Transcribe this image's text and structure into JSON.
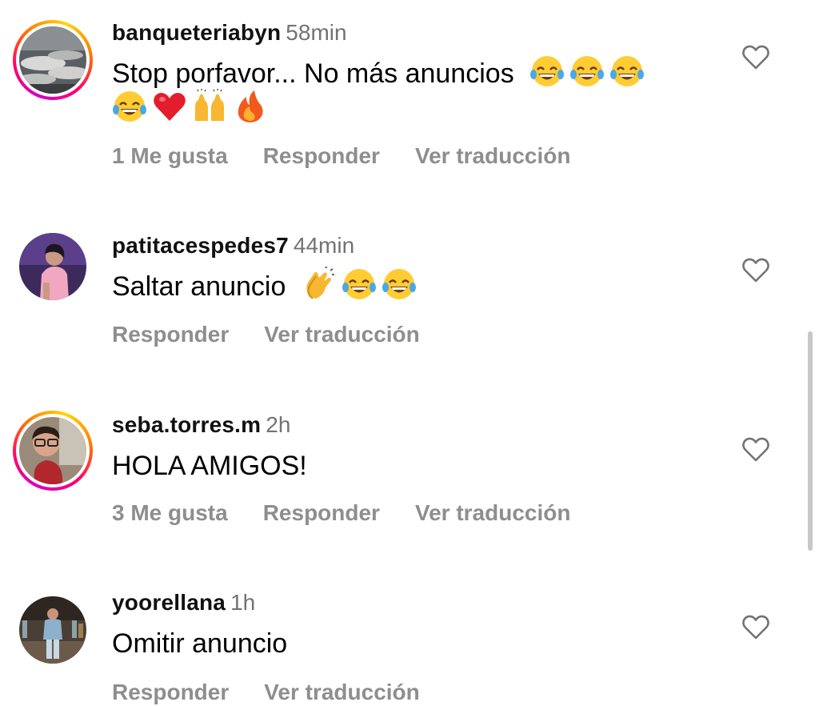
{
  "comments": [
    {
      "username": "banqueteriabyn",
      "time": "58min",
      "text_line1": "Stop porfavor... No más anuncios",
      "line1_emojis": [
        "laughing-emoji",
        "laughing-emoji",
        "laughing-emoji"
      ],
      "line2_emojis": [
        "laughing-emoji",
        "red-heart-emoji",
        "raising-hands-emoji",
        "fire-emoji"
      ],
      "likes": "1 Me gusta",
      "reply": "Responder",
      "translate": "Ver traducción",
      "avatar": "banquet-tables-photo",
      "story_ring": true
    },
    {
      "username": "patitacespedes7",
      "time": "44min",
      "text_line1": "Saltar anuncio",
      "line1_emojis": [
        "clapping-hands-emoji",
        "laughing-emoji",
        "laughing-emoji"
      ],
      "likes": "",
      "reply": "Responder",
      "translate": "Ver traducción",
      "avatar": "person-purple-background-photo",
      "story_ring": false
    },
    {
      "username": "seba.torres.m",
      "time": "2h",
      "text_line1": "HOLA AMIGOS!",
      "likes": "3 Me gusta",
      "reply": "Responder",
      "translate": "Ver traducción",
      "avatar": "man-with-glasses-photo",
      "story_ring": true
    },
    {
      "username": "yoorellana",
      "time": "1h",
      "text_line1": "Omitir anuncio",
      "likes": "",
      "reply": "Responder",
      "translate": "Ver traducción",
      "avatar": "man-standing-bar-photo",
      "story_ring": false
    }
  ],
  "colors": {
    "text": "#000000",
    "username": "#111111",
    "muted": "#737373",
    "action": "#8e8e8e",
    "scrollbar": "#c8c8c8"
  },
  "icons": {
    "like": "heart-outline-icon"
  }
}
